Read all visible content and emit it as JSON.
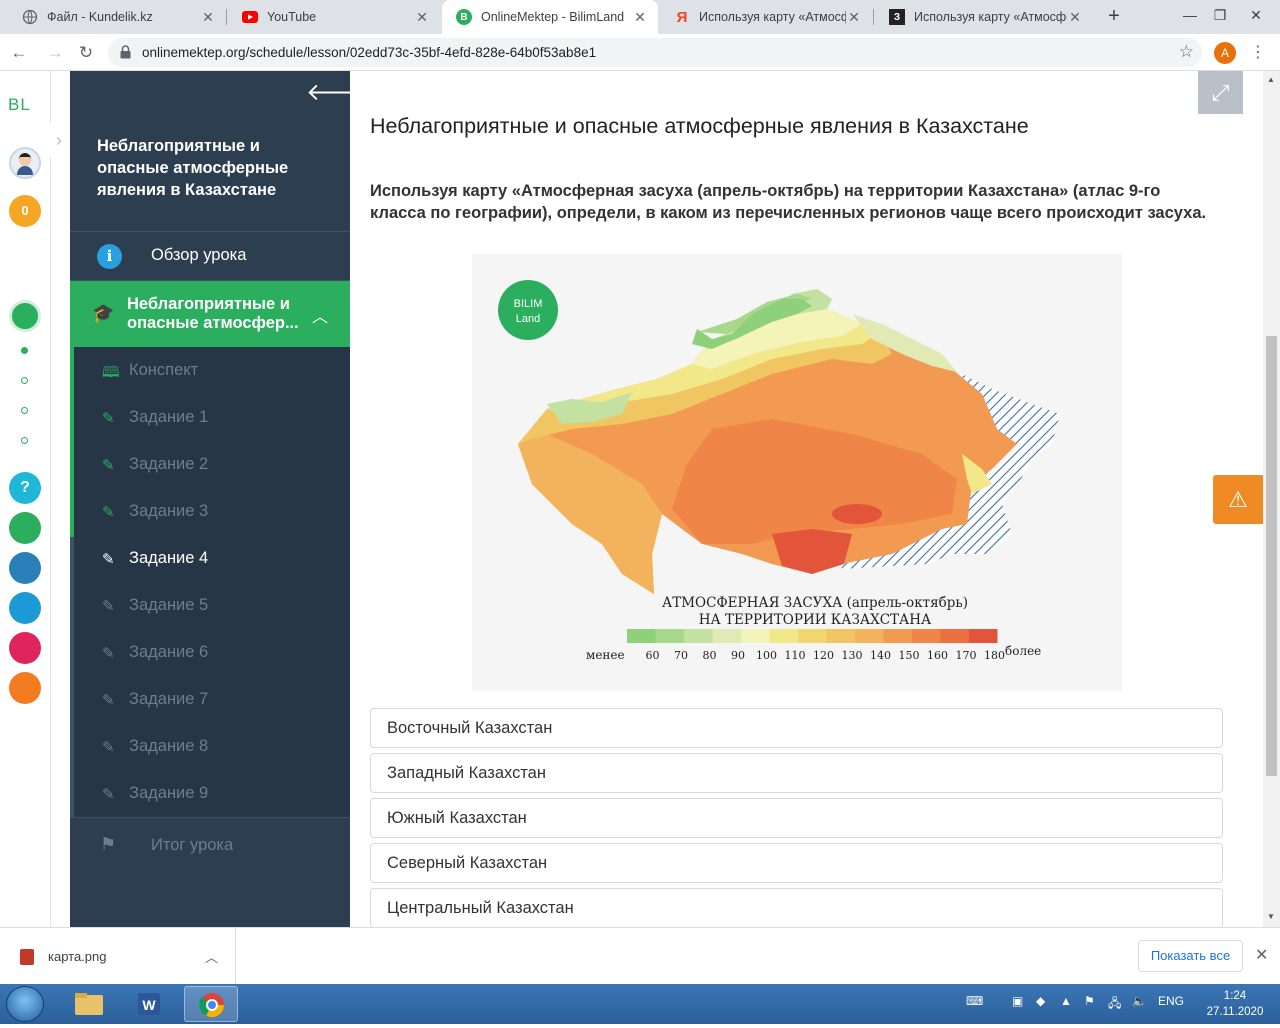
{
  "browser": {
    "tabs": [
      {
        "title": "Файл - Kundelik.kz",
        "favicon": "globe-icon"
      },
      {
        "title": "YouTube",
        "favicon": "youtube-icon"
      },
      {
        "title": "OnlineMektep - BilimLand",
        "favicon": "bilimland-icon"
      },
      {
        "title": "Используя карту «Атмосфе",
        "favicon": "yandex-icon"
      },
      {
        "title": "Используя карту «Атмосфе",
        "favicon": "znanija-icon"
      }
    ],
    "active_tab": 2,
    "new_tab": "+",
    "url": "onlinemektep.org/schedule/lesson/02edd73c-35bf-4efd-828e-64b0f53ab8e1",
    "profile_initial": "A"
  },
  "rail": {
    "logo": "BL",
    "score": "0",
    "help": "?"
  },
  "sidebar": {
    "title": "Неблагоприятные и опасные атмосферные явления в Казахстане",
    "overview": "Обзор урока",
    "section": "Неблагоприятные и опасные атмосфер...",
    "items": [
      {
        "label": "Конспект",
        "state": "done",
        "icon": "book-icon"
      },
      {
        "label": "Задание 1",
        "state": "done",
        "icon": "edit-icon"
      },
      {
        "label": "Задание 2",
        "state": "done",
        "icon": "edit-icon"
      },
      {
        "label": "Задание 3",
        "state": "done",
        "icon": "edit-icon"
      },
      {
        "label": "Задание 4",
        "state": "current",
        "icon": "edit-icon"
      },
      {
        "label": "Задание 5",
        "state": "pending",
        "icon": "edit-icon"
      },
      {
        "label": "Задание 6",
        "state": "pending",
        "icon": "edit-icon"
      },
      {
        "label": "Задание 7",
        "state": "pending",
        "icon": "edit-icon"
      },
      {
        "label": "Задание 8",
        "state": "pending",
        "icon": "edit-icon"
      },
      {
        "label": "Задание 9",
        "state": "pending",
        "icon": "edit-icon"
      }
    ],
    "result": "Итог урока"
  },
  "main": {
    "heading": "Неблагоприятные и опасные атмосферные явления в Казахстане",
    "question": "Используя карту «Атмосферная засуха (апрель-октябрь) на территории Казахстана» (атлас 9-го класса по географии), определи, в каком из перечисленных регионов чаще всего происходит засуха.",
    "map": {
      "logo_line1": "BILIM",
      "logo_line2": "Land",
      "title_line1": "АТМОСФЕРНАЯ ЗАСУХА (апрель-октябрь)",
      "title_line2": "НА ТЕРРИТОРИИ КАЗАХСТАНА",
      "legend_less": "менее",
      "legend_more": "более",
      "legend_ticks": [
        "60",
        "70",
        "80",
        "90",
        "100",
        "110",
        "120",
        "130",
        "140",
        "150",
        "160",
        "170",
        "180"
      ],
      "legend_colors": [
        "#8fd07a",
        "#a8d98a",
        "#c3e1a0",
        "#e1eab5",
        "#f4f3b8",
        "#f2e88a",
        "#f0d86f",
        "#f0c662",
        "#f3b35c",
        "#f29a52",
        "#ef8648",
        "#ea7040",
        "#e3553a"
      ]
    },
    "answers": [
      "Восточный Казахстан",
      "Западный Казахстан",
      "Южный Казахстан",
      "Северный Казахстан",
      "Центральный Казахстан"
    ]
  },
  "downloads": {
    "file": "карта.png",
    "show_all": "Показать все"
  },
  "taskbar": {
    "lang": "ENG",
    "time": "1:24",
    "date": "27.11.2020"
  }
}
